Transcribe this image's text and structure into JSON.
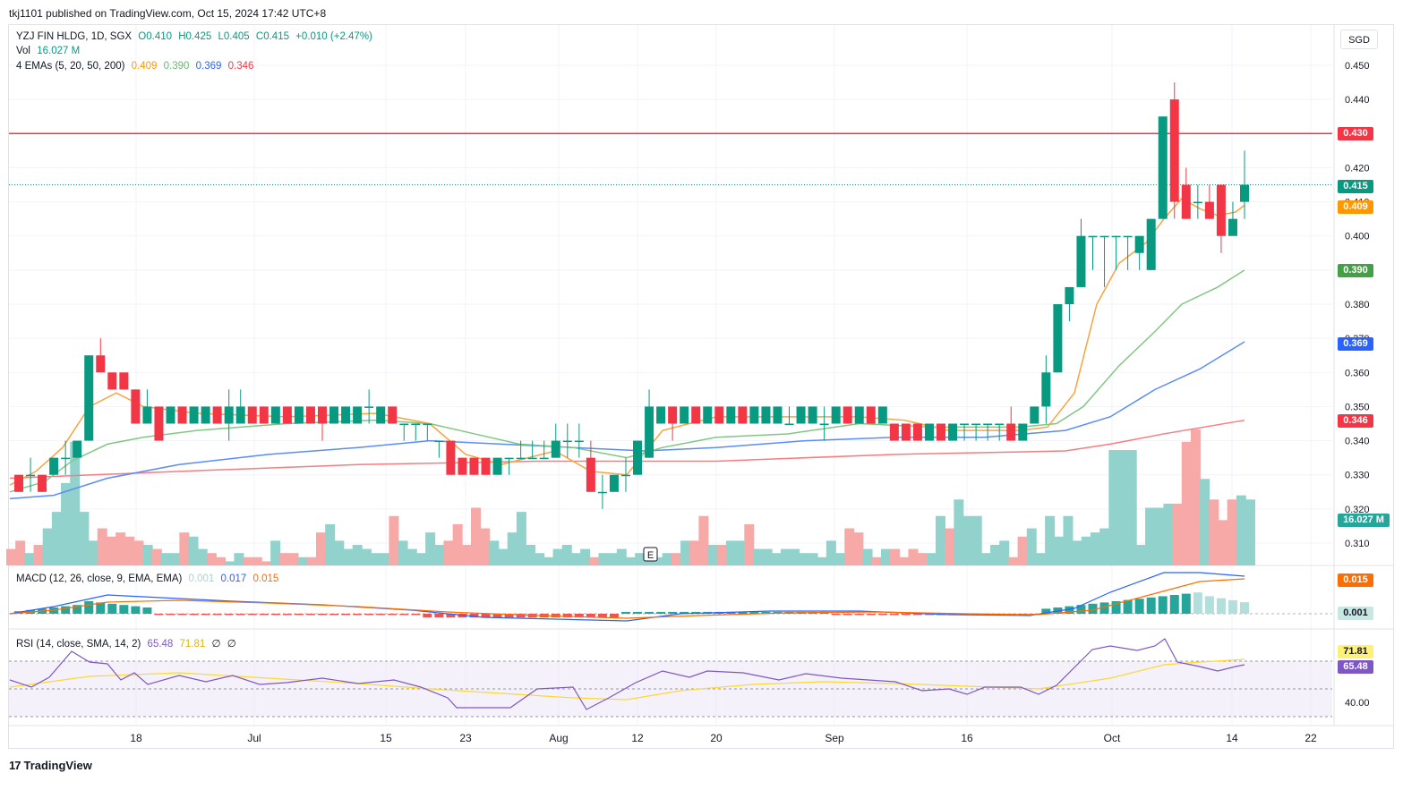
{
  "publish_line": "tkj1101 published on TradingView.com, Oct 15, 2024 17:42 UTC+8",
  "footer_brand": "TradingView",
  "currency": "SGD",
  "legend": {
    "symbol": "YZJ FIN HLDG, 1D, SGX",
    "o": "O0.410",
    "h": "H0.425",
    "l": "L0.405",
    "c": "C0.415",
    "change": "+0.010 (+2.47%)",
    "vol_label": "Vol",
    "vol_value": "16.027 M",
    "ema_label": "4 EMAs (5, 20, 50, 200)",
    "ema5": "0.409",
    "ema20": "0.390",
    "ema50": "0.369",
    "ema200": "0.346"
  },
  "macd_legend": {
    "label": "MACD (12, 26, close, 9, EMA, EMA)",
    "hist": "0.001",
    "macd": "0.017",
    "signal": "0.015"
  },
  "rsi_legend": {
    "label": "RSI (14, close, SMA, 14, 2)",
    "rsi": "65.48",
    "sma": "71.81",
    "x1": "∅",
    "x2": "∅"
  },
  "badges": {
    "resistance": "0.430",
    "last": "0.415",
    "ema5": "0.409",
    "ema20": "0.390",
    "ema50": "0.369",
    "ema200": "0.346",
    "volume": "16.027 M",
    "macd_signal": "0.015",
    "macd_hist": "0.001",
    "rsi_sma": "71.81",
    "rsi": "65.48"
  },
  "colors": {
    "up": "#089981",
    "down": "#f23645",
    "ema5": "#ff9800",
    "ema20": "#66bb6a",
    "ema50": "#2962ff",
    "ema200": "#f23645",
    "resistance": "#f23645",
    "macd": "#2962ff",
    "signal": "#ff6d00",
    "rsi": "#7e57c2",
    "rsi_sma": "#fdd835"
  },
  "earnings_marker": "E",
  "chart_data": {
    "type": "candlestick",
    "y_ticks": [
      "0.450",
      "0.440",
      "0.420",
      "0.410",
      "0.400",
      "0.390",
      "0.380",
      "0.370",
      "0.360",
      "0.350",
      "0.340",
      "0.330",
      "0.320",
      "0.310"
    ],
    "ylim": [
      0.306,
      0.453
    ],
    "x_ticks": [
      "18",
      "Jul",
      "15",
      "23",
      "Aug",
      "12",
      "20",
      "Sep",
      "16",
      "Oct",
      "14",
      "22"
    ],
    "resistance": 0.43,
    "candles": [
      [
        0.33,
        0.33,
        0.325,
        0.325
      ],
      [
        0.33,
        0.335,
        0.325,
        0.33
      ],
      [
        0.33,
        0.33,
        0.325,
        0.325
      ],
      [
        0.33,
        0.335,
        0.33,
        0.335
      ],
      [
        0.335,
        0.34,
        0.33,
        0.335
      ],
      [
        0.335,
        0.34,
        0.335,
        0.34
      ],
      [
        0.34,
        0.365,
        0.34,
        0.365
      ],
      [
        0.365,
        0.37,
        0.36,
        0.36
      ],
      [
        0.36,
        0.36,
        0.355,
        0.355
      ],
      [
        0.36,
        0.36,
        0.355,
        0.355
      ],
      [
        0.355,
        0.355,
        0.345,
        0.345
      ],
      [
        0.345,
        0.355,
        0.345,
        0.35
      ],
      [
        0.35,
        0.35,
        0.34,
        0.34
      ],
      [
        0.345,
        0.35,
        0.345,
        0.35
      ],
      [
        0.35,
        0.35,
        0.345,
        0.345
      ],
      [
        0.345,
        0.35,
        0.345,
        0.35
      ],
      [
        0.345,
        0.35,
        0.345,
        0.35
      ],
      [
        0.35,
        0.35,
        0.345,
        0.345
      ],
      [
        0.345,
        0.355,
        0.34,
        0.35
      ],
      [
        0.345,
        0.355,
        0.345,
        0.35
      ],
      [
        0.35,
        0.35,
        0.345,
        0.345
      ],
      [
        0.35,
        0.35,
        0.345,
        0.345
      ],
      [
        0.345,
        0.35,
        0.345,
        0.35
      ],
      [
        0.35,
        0.35,
        0.345,
        0.345
      ],
      [
        0.345,
        0.35,
        0.345,
        0.35
      ],
      [
        0.35,
        0.35,
        0.345,
        0.345
      ],
      [
        0.35,
        0.35,
        0.34,
        0.345
      ],
      [
        0.345,
        0.35,
        0.345,
        0.35
      ],
      [
        0.345,
        0.35,
        0.345,
        0.35
      ],
      [
        0.345,
        0.35,
        0.345,
        0.35
      ],
      [
        0.35,
        0.355,
        0.345,
        0.35
      ],
      [
        0.345,
        0.35,
        0.345,
        0.35
      ],
      [
        0.35,
        0.35,
        0.345,
        0.345
      ],
      [
        0.345,
        0.345,
        0.34,
        0.345
      ],
      [
        0.345,
        0.345,
        0.34,
        0.345
      ],
      [
        0.345,
        0.345,
        0.34,
        0.345
      ],
      [
        0.34,
        0.34,
        0.335,
        0.34
      ],
      [
        0.34,
        0.34,
        0.33,
        0.33
      ],
      [
        0.335,
        0.335,
        0.33,
        0.33
      ],
      [
        0.335,
        0.335,
        0.33,
        0.33
      ],
      [
        0.335,
        0.335,
        0.33,
        0.33
      ],
      [
        0.33,
        0.335,
        0.33,
        0.335
      ],
      [
        0.335,
        0.335,
        0.33,
        0.335
      ],
      [
        0.335,
        0.34,
        0.335,
        0.335
      ],
      [
        0.335,
        0.34,
        0.335,
        0.335
      ],
      [
        0.335,
        0.34,
        0.335,
        0.335
      ],
      [
        0.335,
        0.345,
        0.335,
        0.34
      ],
      [
        0.34,
        0.345,
        0.335,
        0.34
      ],
      [
        0.34,
        0.345,
        0.335,
        0.34
      ],
      [
        0.335,
        0.34,
        0.325,
        0.325
      ],
      [
        0.325,
        0.33,
        0.32,
        0.325
      ],
      [
        0.325,
        0.33,
        0.325,
        0.33
      ],
      [
        0.33,
        0.335,
        0.325,
        0.33
      ],
      [
        0.33,
        0.34,
        0.33,
        0.34
      ],
      [
        0.335,
        0.355,
        0.335,
        0.35
      ],
      [
        0.345,
        0.35,
        0.345,
        0.35
      ],
      [
        0.35,
        0.35,
        0.34,
        0.345
      ],
      [
        0.345,
        0.35,
        0.345,
        0.35
      ],
      [
        0.35,
        0.35,
        0.345,
        0.345
      ],
      [
        0.345,
        0.35,
        0.345,
        0.35
      ],
      [
        0.35,
        0.35,
        0.345,
        0.345
      ],
      [
        0.345,
        0.35,
        0.345,
        0.35
      ],
      [
        0.35,
        0.35,
        0.345,
        0.345
      ],
      [
        0.345,
        0.35,
        0.345,
        0.35
      ],
      [
        0.345,
        0.35,
        0.345,
        0.35
      ],
      [
        0.345,
        0.35,
        0.345,
        0.35
      ],
      [
        0.345,
        0.35,
        0.345,
        0.345
      ],
      [
        0.345,
        0.35,
        0.345,
        0.35
      ],
      [
        0.345,
        0.35,
        0.345,
        0.35
      ],
      [
        0.345,
        0.35,
        0.34,
        0.345
      ],
      [
        0.345,
        0.35,
        0.345,
        0.35
      ],
      [
        0.35,
        0.35,
        0.345,
        0.345
      ],
      [
        0.345,
        0.35,
        0.345,
        0.35
      ],
      [
        0.35,
        0.35,
        0.345,
        0.345
      ],
      [
        0.345,
        0.35,
        0.345,
        0.35
      ],
      [
        0.345,
        0.345,
        0.34,
        0.34
      ],
      [
        0.345,
        0.345,
        0.34,
        0.34
      ],
      [
        0.345,
        0.345,
        0.34,
        0.34
      ],
      [
        0.34,
        0.345,
        0.34,
        0.345
      ],
      [
        0.345,
        0.345,
        0.34,
        0.34
      ],
      [
        0.34,
        0.345,
        0.34,
        0.345
      ],
      [
        0.345,
        0.345,
        0.34,
        0.345
      ],
      [
        0.345,
        0.345,
        0.34,
        0.345
      ],
      [
        0.345,
        0.345,
        0.34,
        0.345
      ],
      [
        0.345,
        0.345,
        0.34,
        0.345
      ],
      [
        0.345,
        0.35,
        0.34,
        0.34
      ],
      [
        0.34,
        0.345,
        0.34,
        0.345
      ],
      [
        0.345,
        0.35,
        0.345,
        0.35
      ],
      [
        0.35,
        0.365,
        0.345,
        0.36
      ],
      [
        0.36,
        0.38,
        0.36,
        0.38
      ],
      [
        0.38,
        0.385,
        0.375,
        0.385
      ],
      [
        0.385,
        0.405,
        0.385,
        0.4
      ],
      [
        0.4,
        0.4,
        0.39,
        0.4
      ],
      [
        0.4,
        0.4,
        0.385,
        0.4
      ],
      [
        0.4,
        0.4,
        0.39,
        0.4
      ],
      [
        0.4,
        0.4,
        0.39,
        0.4
      ],
      [
        0.395,
        0.4,
        0.39,
        0.4
      ],
      [
        0.39,
        0.405,
        0.39,
        0.405
      ],
      [
        0.405,
        0.435,
        0.405,
        0.435
      ],
      [
        0.44,
        0.445,
        0.405,
        0.41
      ],
      [
        0.415,
        0.42,
        0.405,
        0.405
      ],
      [
        0.41,
        0.415,
        0.405,
        0.41
      ],
      [
        0.41,
        0.415,
        0.405,
        0.405
      ],
      [
        0.415,
        0.415,
        0.395,
        0.4
      ],
      [
        0.4,
        0.41,
        0.4,
        0.405
      ],
      [
        0.41,
        0.425,
        0.405,
        0.415
      ]
    ],
    "ema5_pts": [
      [
        11,
        0.327
      ],
      [
        40,
        0.331
      ],
      [
        70,
        0.338
      ],
      [
        100,
        0.35
      ],
      [
        130,
        0.354
      ],
      [
        160,
        0.35
      ],
      [
        220,
        0.348
      ],
      [
        320,
        0.347
      ],
      [
        420,
        0.348
      ],
      [
        480,
        0.345
      ],
      [
        520,
        0.336
      ],
      [
        560,
        0.333
      ],
      [
        620,
        0.337
      ],
      [
        660,
        0.331
      ],
      [
        700,
        0.33
      ],
      [
        740,
        0.343
      ],
      [
        800,
        0.347
      ],
      [
        880,
        0.347
      ],
      [
        960,
        0.347
      ],
      [
        1010,
        0.346
      ],
      [
        1060,
        0.343
      ],
      [
        1140,
        0.343
      ],
      [
        1170,
        0.344
      ],
      [
        1200,
        0.354
      ],
      [
        1225,
        0.38
      ],
      [
        1250,
        0.392
      ],
      [
        1280,
        0.398
      ],
      [
        1300,
        0.405
      ],
      [
        1320,
        0.411
      ],
      [
        1340,
        0.408
      ],
      [
        1360,
        0.406
      ],
      [
        1380,
        0.407
      ],
      [
        1390,
        0.409
      ]
    ],
    "ema20_pts": [
      [
        11,
        0.325
      ],
      [
        50,
        0.328
      ],
      [
        80,
        0.334
      ],
      [
        120,
        0.339
      ],
      [
        160,
        0.341
      ],
      [
        220,
        0.343
      ],
      [
        320,
        0.345
      ],
      [
        420,
        0.346
      ],
      [
        480,
        0.345
      ],
      [
        530,
        0.342
      ],
      [
        580,
        0.339
      ],
      [
        640,
        0.338
      ],
      [
        700,
        0.335
      ],
      [
        740,
        0.338
      ],
      [
        800,
        0.341
      ],
      [
        880,
        0.342
      ],
      [
        960,
        0.345
      ],
      [
        1040,
        0.344
      ],
      [
        1140,
        0.344
      ],
      [
        1180,
        0.345
      ],
      [
        1210,
        0.35
      ],
      [
        1250,
        0.362
      ],
      [
        1290,
        0.372
      ],
      [
        1320,
        0.38
      ],
      [
        1360,
        0.385
      ],
      [
        1390,
        0.39
      ]
    ],
    "ema50_pts": [
      [
        11,
        0.323
      ],
      [
        60,
        0.324
      ],
      [
        120,
        0.329
      ],
      [
        200,
        0.333
      ],
      [
        300,
        0.336
      ],
      [
        400,
        0.338
      ],
      [
        480,
        0.34
      ],
      [
        560,
        0.339
      ],
      [
        640,
        0.338
      ],
      [
        720,
        0.337
      ],
      [
        800,
        0.338
      ],
      [
        900,
        0.34
      ],
      [
        1000,
        0.341
      ],
      [
        1100,
        0.341
      ],
      [
        1190,
        0.343
      ],
      [
        1240,
        0.347
      ],
      [
        1290,
        0.355
      ],
      [
        1340,
        0.361
      ],
      [
        1390,
        0.369
      ]
    ],
    "ema200_pts": [
      [
        11,
        0.329
      ],
      [
        200,
        0.331
      ],
      [
        400,
        0.333
      ],
      [
        600,
        0.334
      ],
      [
        800,
        0.334
      ],
      [
        1000,
        0.336
      ],
      [
        1190,
        0.337
      ],
      [
        1240,
        0.339
      ],
      [
        1300,
        0.342
      ],
      [
        1390,
        0.346
      ]
    ],
    "volume": [
      4,
      6,
      3,
      5,
      9,
      13,
      20,
      30,
      13,
      6,
      9,
      7,
      8,
      7,
      6,
      5,
      4,
      3,
      3,
      8,
      7,
      4,
      3,
      2,
      1,
      3,
      2,
      2,
      1,
      6,
      3,
      3,
      2,
      2,
      8,
      10,
      6,
      4,
      5,
      4,
      3,
      3,
      12,
      6,
      4,
      3,
      8,
      5,
      6,
      10,
      5,
      14,
      9,
      6,
      4,
      8,
      13,
      5,
      3,
      2,
      4,
      5,
      3,
      4,
      2,
      3,
      3,
      4,
      2,
      3,
      3,
      2,
      3,
      3,
      6,
      6,
      12,
      5,
      5,
      6,
      6,
      10,
      4,
      4,
      3,
      4,
      4,
      3,
      3,
      2,
      6,
      3,
      9,
      8,
      4,
      2,
      4,
      4,
      2,
      4,
      3,
      3,
      12,
      9,
      16,
      12,
      12,
      3,
      5,
      6,
      2,
      7,
      9,
      3,
      12,
      7,
      12,
      6,
      7,
      8,
      9,
      28,
      28,
      28,
      5,
      14,
      14,
      15,
      15,
      30,
      33,
      21,
      16,
      11,
      16,
      17,
      16
    ]
  }
}
